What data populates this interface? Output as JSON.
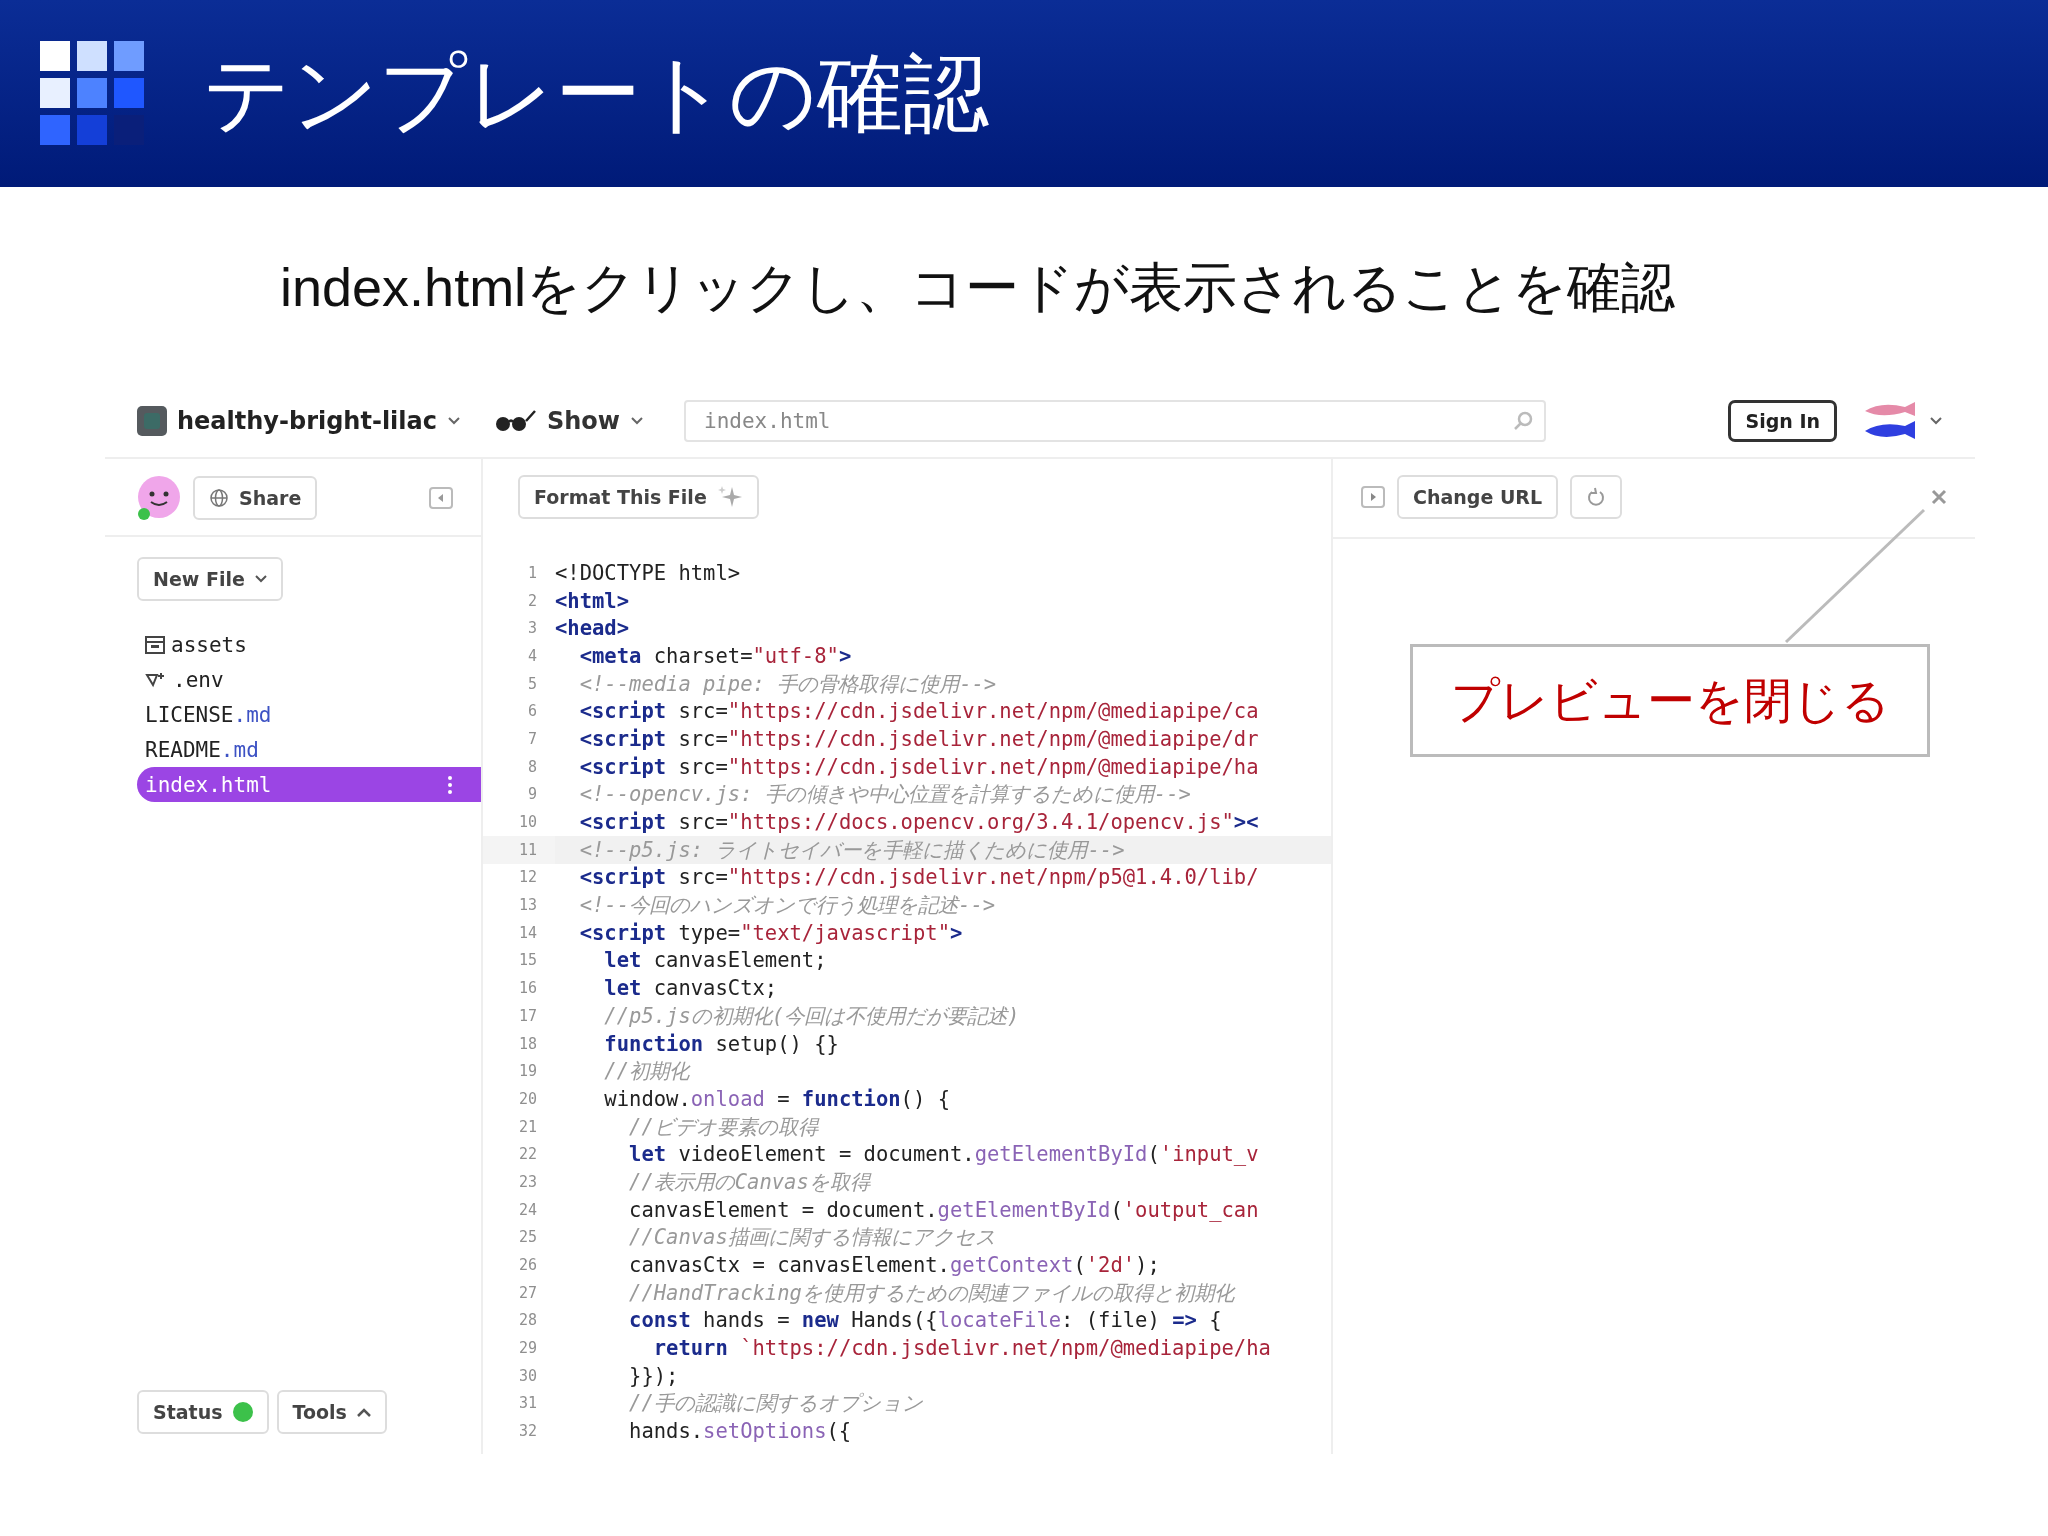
{
  "slide": {
    "title": "テンプレートの確認",
    "subtitle": "index.htmlをクリックし、コードが表示されることを確認"
  },
  "topbar": {
    "project": "healthy-bright-lilac",
    "show": "Show",
    "search": {
      "value": "index.html"
    },
    "sign_in": "Sign In"
  },
  "sidebar": {
    "share": "Share",
    "new_file": "New File",
    "files": [
      {
        "kind": "folder",
        "name": "assets",
        "selected": false
      },
      {
        "kind": "env",
        "name": ".env",
        "selected": false
      },
      {
        "kind": "file",
        "name": "LICENSE",
        "ext": ".md",
        "selected": false
      },
      {
        "kind": "file",
        "name": "README",
        "ext": ".md",
        "selected": false
      },
      {
        "kind": "file",
        "name": "index.html",
        "selected": true
      }
    ],
    "status": {
      "label": "Status",
      "color": "#3cc14a"
    },
    "tools": "Tools"
  },
  "editor": {
    "format_button": "Format This File",
    "lines": [
      {
        "number": "1",
        "active": false,
        "tokens": [
          {
            "kind": "plain",
            "t": "<!DOCTYPE html>"
          }
        ]
      },
      {
        "number": "2",
        "active": false,
        "tokens": [
          {
            "kind": "tag",
            "t": "<html>"
          }
        ]
      },
      {
        "number": "3",
        "active": false,
        "tokens": [
          {
            "kind": "tag",
            "t": "<head>"
          }
        ]
      },
      {
        "number": "4",
        "active": false,
        "tokens": [
          {
            "kind": "tag",
            "t": "  <meta"
          },
          {
            "kind": "plain",
            "t": " charset="
          },
          {
            "kind": "str",
            "t": "\"utf-8\""
          },
          {
            "kind": "tag",
            "t": ">"
          }
        ]
      },
      {
        "number": "5",
        "active": false,
        "tokens": [
          {
            "kind": "comment",
            "t": "  <!--media pipe: 手の骨格取得に使用-->"
          }
        ]
      },
      {
        "number": "6",
        "active": false,
        "tokens": [
          {
            "kind": "tag",
            "t": "  <script"
          },
          {
            "kind": "plain",
            "t": " src="
          },
          {
            "kind": "str",
            "t": "\"https://cdn.jsdelivr.net/npm/@mediapipe/ca"
          }
        ]
      },
      {
        "number": "7",
        "active": false,
        "tokens": [
          {
            "kind": "tag",
            "t": "  <script"
          },
          {
            "kind": "plain",
            "t": " src="
          },
          {
            "kind": "str",
            "t": "\"https://cdn.jsdelivr.net/npm/@mediapipe/dr"
          }
        ]
      },
      {
        "number": "8",
        "active": false,
        "tokens": [
          {
            "kind": "tag",
            "t": "  <script"
          },
          {
            "kind": "plain",
            "t": " src="
          },
          {
            "kind": "str",
            "t": "\"https://cdn.jsdelivr.net/npm/@mediapipe/ha"
          }
        ]
      },
      {
        "number": "9",
        "active": false,
        "tokens": [
          {
            "kind": "comment",
            "t": "  <!--opencv.js: 手の傾きや中心位置を計算するために使用-->"
          }
        ]
      },
      {
        "number": "10",
        "active": false,
        "tokens": [
          {
            "kind": "tag",
            "t": "  <script"
          },
          {
            "kind": "plain",
            "t": " src="
          },
          {
            "kind": "str",
            "t": "\"https://docs.opencv.org/3.4.1/opencv.js\""
          },
          {
            "kind": "tag",
            "t": "><"
          }
        ]
      },
      {
        "number": "11",
        "active": true,
        "tokens": [
          {
            "kind": "comment",
            "t": "  <!--p5.js: ライトセイバーを手軽に描くために使用-->"
          }
        ]
      },
      {
        "number": "12",
        "active": false,
        "tokens": [
          {
            "kind": "tag",
            "t": "  <script"
          },
          {
            "kind": "plain",
            "t": " src="
          },
          {
            "kind": "str",
            "t": "\"https://cdn.jsdelivr.net/npm/p5@1.4.0/lib/"
          }
        ]
      },
      {
        "number": "13",
        "active": false,
        "tokens": [
          {
            "kind": "comment",
            "t": "  <!--今回のハンズオンで行う処理を記述-->"
          }
        ]
      },
      {
        "number": "14",
        "active": false,
        "tokens": [
          {
            "kind": "tag",
            "t": "  <script"
          },
          {
            "kind": "plain",
            "t": " type="
          },
          {
            "kind": "str",
            "t": "\"text/javascript\""
          },
          {
            "kind": "tag",
            "t": ">"
          }
        ]
      },
      {
        "number": "15",
        "active": false,
        "tokens": [
          {
            "kind": "kw",
            "t": "    let"
          },
          {
            "kind": "plain",
            "t": " canvasElement;"
          }
        ]
      },
      {
        "number": "16",
        "active": false,
        "tokens": [
          {
            "kind": "kw",
            "t": "    let"
          },
          {
            "kind": "plain",
            "t": " canvasCtx;"
          }
        ]
      },
      {
        "number": "17",
        "active": false,
        "tokens": [
          {
            "kind": "comment",
            "t": "    //p5.jsの初期化(今回は不使用だが要記述)"
          }
        ]
      },
      {
        "number": "18",
        "active": false,
        "tokens": [
          {
            "kind": "kw",
            "t": "    function"
          },
          {
            "kind": "plain",
            "t": " setup() {}"
          }
        ]
      },
      {
        "number": "19",
        "active": false,
        "tokens": [
          {
            "kind": "comment",
            "t": "    //初期化"
          }
        ]
      },
      {
        "number": "20",
        "active": false,
        "tokens": [
          {
            "kind": "plain",
            "t": "    window."
          },
          {
            "kind": "prop",
            "t": "onload"
          },
          {
            "kind": "plain",
            "t": " = "
          },
          {
            "kind": "kw",
            "t": "function"
          },
          {
            "kind": "plain",
            "t": "() {"
          }
        ]
      },
      {
        "number": "21",
        "active": false,
        "tokens": [
          {
            "kind": "comment",
            "t": "      //ビデオ要素の取得"
          }
        ]
      },
      {
        "number": "22",
        "active": false,
        "tokens": [
          {
            "kind": "kw",
            "t": "      let"
          },
          {
            "kind": "plain",
            "t": " videoElement = document."
          },
          {
            "kind": "prop",
            "t": "getElementById"
          },
          {
            "kind": "plain",
            "t": "("
          },
          {
            "kind": "str",
            "t": "'input_v"
          }
        ]
      },
      {
        "number": "23",
        "active": false,
        "tokens": [
          {
            "kind": "comment",
            "t": "      //表示用のCanvasを取得"
          }
        ]
      },
      {
        "number": "24",
        "active": false,
        "tokens": [
          {
            "kind": "plain",
            "t": "      canvasElement = document."
          },
          {
            "kind": "prop",
            "t": "getElementById"
          },
          {
            "kind": "plain",
            "t": "("
          },
          {
            "kind": "str",
            "t": "'output_can"
          }
        ]
      },
      {
        "number": "25",
        "active": false,
        "tokens": [
          {
            "kind": "comment",
            "t": "      //Canvas描画に関する情報にアクセス"
          }
        ]
      },
      {
        "number": "26",
        "active": false,
        "tokens": [
          {
            "kind": "plain",
            "t": "      canvasCtx = canvasElement."
          },
          {
            "kind": "prop",
            "t": "getContext"
          },
          {
            "kind": "plain",
            "t": "("
          },
          {
            "kind": "str",
            "t": "'2d'"
          },
          {
            "kind": "plain",
            "t": ");"
          }
        ]
      },
      {
        "number": "27",
        "active": false,
        "tokens": [
          {
            "kind": "comment",
            "t": "      //HandTrackingを使用するための関連ファイルの取得と初期化"
          }
        ]
      },
      {
        "number": "28",
        "active": false,
        "tokens": [
          {
            "kind": "kw",
            "t": "      const"
          },
          {
            "kind": "plain",
            "t": " hands = "
          },
          {
            "kind": "kw",
            "t": "new"
          },
          {
            "kind": "plain",
            "t": " Hands({"
          },
          {
            "kind": "prop",
            "t": "locateFile"
          },
          {
            "kind": "plain",
            "t": ": (file) "
          },
          {
            "kind": "kw",
            "t": "=>"
          },
          {
            "kind": "plain",
            "t": " {"
          }
        ]
      },
      {
        "number": "29",
        "active": false,
        "tokens": [
          {
            "kind": "kw",
            "t": "        return"
          },
          {
            "kind": "str",
            "t": " `https://cdn.jsdelivr.net/npm/@mediapipe/ha"
          }
        ]
      },
      {
        "number": "30",
        "active": false,
        "tokens": [
          {
            "kind": "plain",
            "t": "      }});"
          }
        ]
      },
      {
        "number": "31",
        "active": false,
        "tokens": [
          {
            "kind": "comment",
            "t": "      //手の認識に関するオプション"
          }
        ]
      },
      {
        "number": "32",
        "active": false,
        "tokens": [
          {
            "kind": "plain",
            "t": "      hands."
          },
          {
            "kind": "prop",
            "t": "setOptions"
          },
          {
            "kind": "plain",
            "t": "({"
          }
        ]
      }
    ]
  },
  "preview": {
    "change_url": "Change URL"
  },
  "callout": {
    "text": "プレビューを閉じる"
  }
}
